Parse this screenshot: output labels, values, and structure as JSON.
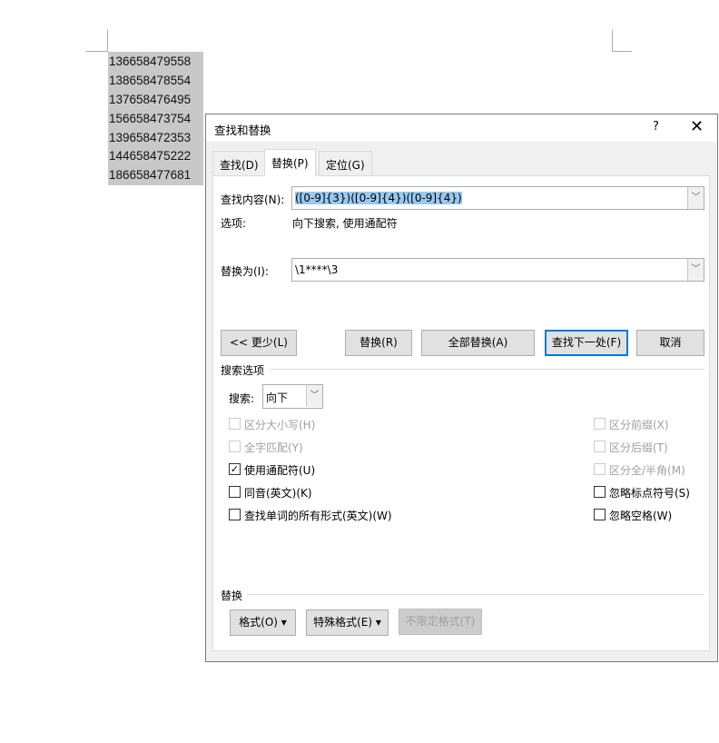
{
  "document": {
    "lines": [
      "136658479558",
      "138658478554",
      "137658476495",
      "156658473754",
      "139658472353",
      "144658475222",
      "186658477681"
    ]
  },
  "dialog": {
    "title": "查找和替换",
    "help": "?",
    "close": "✕",
    "tabs": [
      {
        "label": "查找(D)"
      },
      {
        "label": "替换(P)",
        "active": true
      },
      {
        "label": "定位(G)"
      }
    ],
    "find_label": "查找内容(N):",
    "find_value": "([0-9]{3})([0-9]{4})([0-9]{4})",
    "options_label": "选项:",
    "options_value": "向下搜索, 使用通配符",
    "replace_label": "替换为(I):",
    "replace_value": "\\1****\\3",
    "buttons": {
      "less": "<< 更少(L)",
      "replace": "替换(R)",
      "replace_all": "全部替换(A)",
      "find_next": "查找下一处(F)",
      "cancel": "取消"
    },
    "search_options_title": "搜索选项",
    "search_label": "搜索:",
    "search_value": "向下",
    "checkboxes_left": [
      {
        "label": "区分大小写(H)",
        "checked": false,
        "disabled": true
      },
      {
        "label": "全字匹配(Y)",
        "checked": false,
        "disabled": true
      },
      {
        "label": "使用通配符(U)",
        "checked": true,
        "disabled": false
      },
      {
        "label": "同音(英文)(K)",
        "checked": false,
        "disabled": false
      },
      {
        "label": "查找单词的所有形式(英文)(W)",
        "checked": false,
        "disabled": false
      }
    ],
    "checkboxes_right": [
      {
        "label": "区分前缀(X)",
        "checked": false,
        "disabled": true
      },
      {
        "label": "区分后缀(T)",
        "checked": false,
        "disabled": true
      },
      {
        "label": "区分全/半角(M)",
        "checked": false,
        "disabled": true
      },
      {
        "label": "忽略标点符号(S)",
        "checked": false,
        "disabled": false
      },
      {
        "label": "忽略空格(W)",
        "checked": false,
        "disabled": false
      }
    ],
    "replace_section_title": "替换",
    "format_buttons": {
      "format": "格式(O) ▾",
      "special": "特殊格式(E) ▾",
      "no_format": "不限定格式(T)"
    }
  }
}
